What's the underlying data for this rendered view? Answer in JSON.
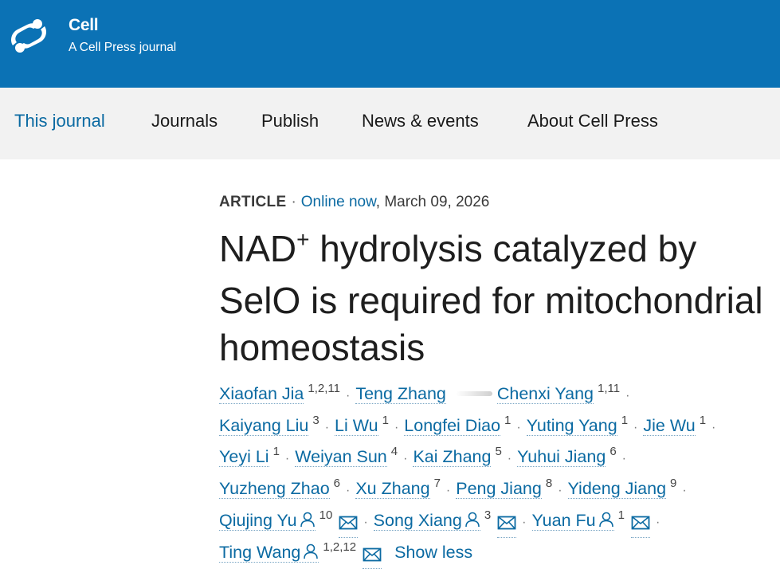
{
  "header": {
    "brand_name": "Cell",
    "brand_subtitle": "A Cell Press journal",
    "logo_icon": "cell-press-logo-icon",
    "brand_color": "#0b72b5"
  },
  "nav": {
    "items": [
      {
        "label": "This journal",
        "active": true
      },
      {
        "label": "Journals",
        "active": false
      },
      {
        "label": "Publish",
        "active": false
      },
      {
        "label": "News & events",
        "active": false
      },
      {
        "label": "About Cell Press",
        "active": false
      }
    ]
  },
  "article": {
    "type": "ARTICLE",
    "separator": "·",
    "online_label": "Online now",
    "date": ", March 09, 2026",
    "title_part1": "NAD",
    "title_sup": "+",
    "title_part2": " hydrolysis catalyzed by SelO is required for mitochondrial homeostasis"
  },
  "authors": [
    {
      "name": "Xiaofan Jia",
      "aff": "1,2,11"
    },
    {
      "name": "Teng Zhang",
      "aff": ""
    },
    {
      "name": "Chenxi Yang",
      "aff": "1,11"
    },
    {
      "name": "Kaiyang Liu",
      "aff": "3"
    },
    {
      "name": "Li Wu",
      "aff": "1"
    },
    {
      "name": "Longfei Diao",
      "aff": "1"
    },
    {
      "name": "Yuting Yang",
      "aff": "1"
    },
    {
      "name": "Jie Wu",
      "aff": "1"
    },
    {
      "name": "Yeyi Li",
      "aff": "1"
    },
    {
      "name": "Weiyan Sun",
      "aff": "4"
    },
    {
      "name": "Kai Zhang",
      "aff": "5"
    },
    {
      "name": "Yuhui Jiang",
      "aff": "6"
    },
    {
      "name": "Yuzheng Zhao",
      "aff": "6"
    },
    {
      "name": "Xu Zhang",
      "aff": "7"
    },
    {
      "name": "Peng Jiang",
      "aff": "8"
    },
    {
      "name": "Yideng Jiang",
      "aff": "9"
    },
    {
      "name": "Qiujing Yu",
      "aff": "10"
    },
    {
      "name": "Song Xiang",
      "aff": "3"
    },
    {
      "name": "Yuan Fu",
      "aff": "1"
    },
    {
      "name": "Ting Wang",
      "aff": "1,2,12"
    }
  ],
  "show_less_label": "Show less",
  "icons": {
    "person": "person-icon",
    "mail": "mail-icon"
  },
  "colors": {
    "link": "#0b6aa2",
    "nav_bg": "#f2f2f2"
  }
}
